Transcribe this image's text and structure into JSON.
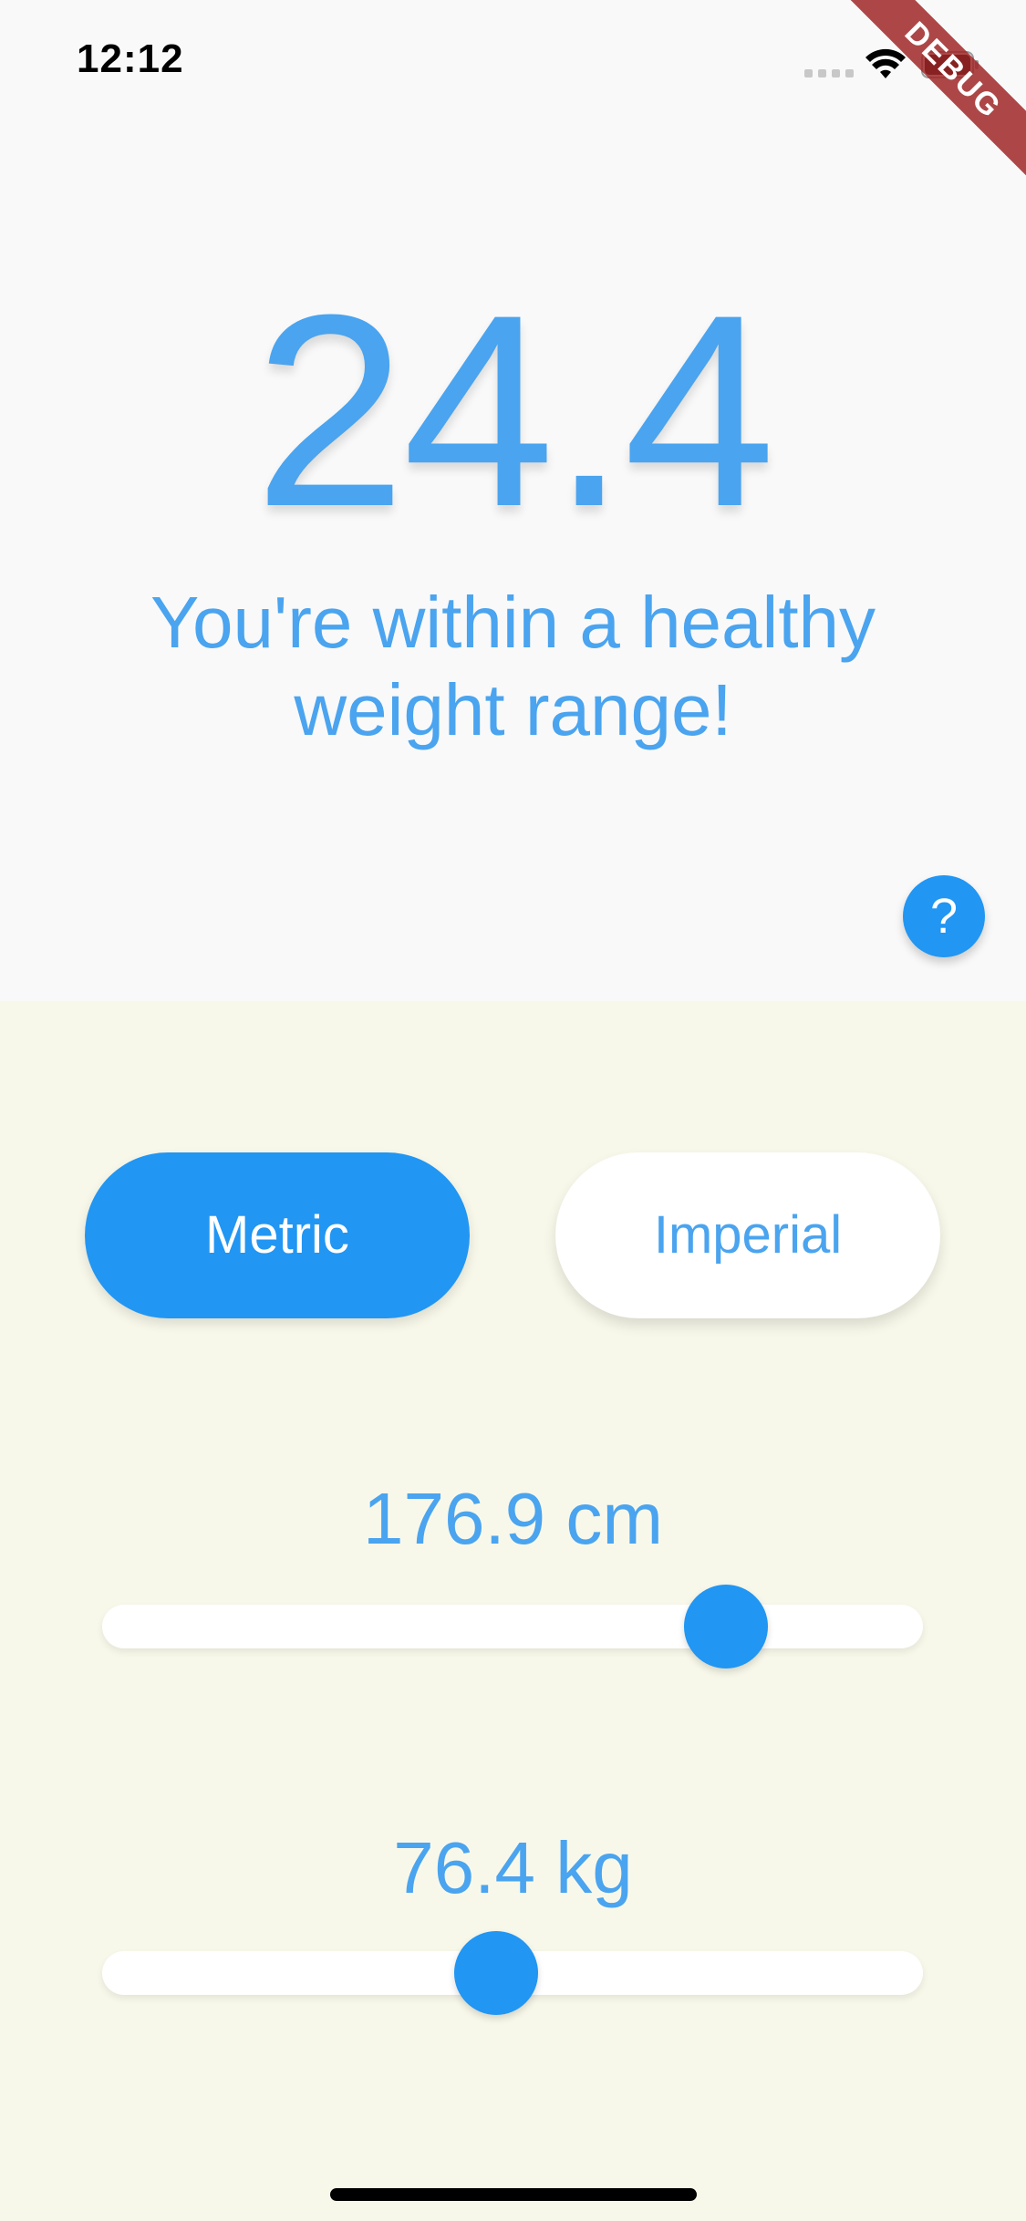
{
  "status_bar": {
    "time": "12:12",
    "icons": [
      "cellular-signal-icon",
      "wifi-icon",
      "battery-icon"
    ]
  },
  "debug_banner": "DEBUG",
  "result": {
    "bmi": "24.4",
    "message": "You're within a healthy weight range!"
  },
  "help_button": {
    "label": "?",
    "icon": "help-icon"
  },
  "unit_toggle": {
    "metric_label": "Metric",
    "imperial_label": "Imperial",
    "selected": "Metric"
  },
  "height": {
    "label": "176.9 cm",
    "slider_fraction": 0.76
  },
  "weight": {
    "label": "76.4 kg",
    "slider_fraction": 0.48
  },
  "colors": {
    "accent": "#2196f3",
    "text_accent": "#4aa4ef",
    "top_background": "#f9f9f9",
    "bottom_background": "#f8f8ea"
  }
}
